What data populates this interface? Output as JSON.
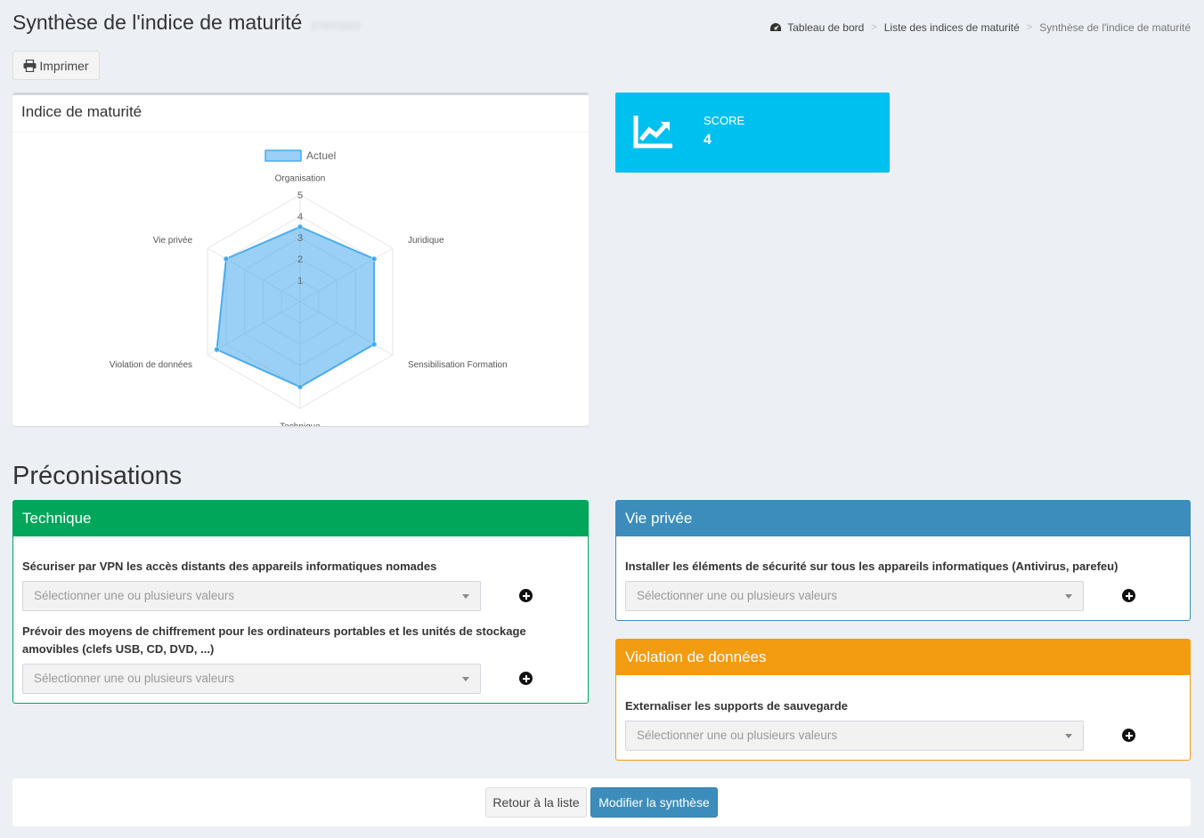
{
  "header": {
    "title": "Synthèse de l'indice de maturité",
    "subtitle": "27/07/2023"
  },
  "breadcrumb": {
    "items": [
      "Tableau de bord",
      "Liste des indices de maturité"
    ],
    "current": "Synthèse de l'indice de maturité",
    "icon": "dashboard-icon"
  },
  "toolbar": {
    "print_label": "Imprimer",
    "print_icon": "print-icon"
  },
  "chart_box": {
    "title": "Indice de maturité"
  },
  "chart_data": {
    "type": "radar",
    "legend": "Actuel",
    "categories": [
      "Organisation",
      "Juridique",
      "Sensibilisation Formation",
      "Technique",
      "Violation de données",
      "Vie privée"
    ],
    "values": [
      3.5,
      4,
      4,
      4,
      4.5,
      4
    ],
    "scale": [
      0,
      5
    ],
    "ticks": [
      "1",
      "2",
      "3",
      "4",
      "5"
    ],
    "color": "#36a2eb"
  },
  "score": {
    "label": "SCORE",
    "value": "4",
    "color": "#00c0ef",
    "icon": "chart-line-icon"
  },
  "recommendations": {
    "title": "Préconisations",
    "placeholder": "Sélectionner une ou plusieurs valeurs",
    "technique": {
      "title": "Technique",
      "color": "#00a65a",
      "items": [
        "Sécuriser par VPN les accès distants des appareils informatiques nomades",
        "Prévoir des moyens de chiffrement pour les ordinateurs portables et les unités de stockage amovibles (clefs USB, CD, DVD, ...)"
      ]
    },
    "vie_privee": {
      "title": "Vie privée",
      "color": "#3c8dbc",
      "items": [
        "Installer les éléments de sécurité sur tous les appareils informatiques (Antivirus, parefeu)"
      ]
    },
    "violation": {
      "title": "Violation de données",
      "color": "#f39c12",
      "items": [
        "Externaliser les supports de sauvegarde"
      ]
    }
  },
  "footer": {
    "back_label": "Retour à la liste",
    "edit_label": "Modifier la synthèse"
  }
}
